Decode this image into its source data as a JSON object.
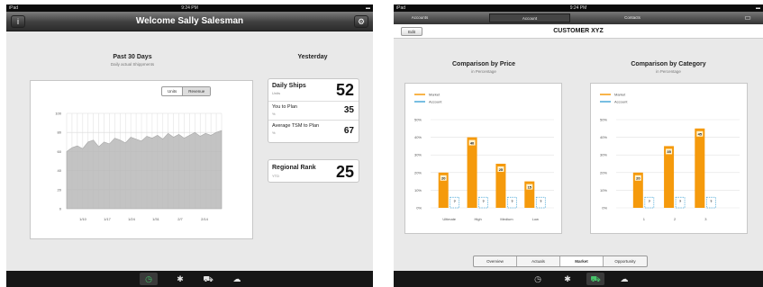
{
  "left": {
    "status": {
      "carrier": "iPad",
      "time": "9:24 PM",
      "battery": "▬"
    },
    "nav": {
      "title": "Welcome Sally Salesman",
      "info_icon": "i",
      "settings_icon": "⚙"
    },
    "chart_section": {
      "title": "Past 30 Days",
      "subtitle": "Daily actual Shippments",
      "seg_units": "Units",
      "seg_revenue": "Revenue"
    },
    "chart_data": {
      "type": "area",
      "title": "Past 30 Days",
      "subtitle": "Daily actual Shippments",
      "x_ticks": [
        "1/10",
        "1/17",
        "1/24",
        "1/31",
        "2/7",
        "2/14"
      ],
      "y_ticks": [
        "0",
        "20",
        "40",
        "60",
        "80",
        "100"
      ],
      "ylim": [
        0,
        100
      ],
      "grid": true,
      "values": [
        60,
        64,
        66,
        63,
        70,
        72,
        65,
        70,
        68,
        74,
        72,
        69,
        75,
        73,
        71,
        76,
        74,
        77,
        73,
        79,
        75,
        78,
        74,
        77,
        80,
        76,
        79,
        77,
        80,
        82
      ]
    },
    "yesterday": {
      "title": "Yesterday",
      "daily_ships_label": "Daily Ships",
      "daily_ships_unit": "Units",
      "daily_ships_value": "52",
      "plan_label": "You to Plan",
      "plan_unit": "%",
      "plan_value": "35",
      "tsm_label": "Average TSM to Plan",
      "tsm_unit": "%",
      "tsm_value": "67",
      "rank_label": "Regional Rank",
      "rank_unit": "YTD",
      "rank_value": "25"
    },
    "tabbar": {
      "tab1_icon": "◷",
      "tab2_icon": "✱",
      "tab3_icon": "⛟",
      "tab4_icon": "☁"
    }
  },
  "right": {
    "status": {
      "carrier": "iPad",
      "time": "9:24 PM",
      "battery": "▬"
    },
    "tabs": {
      "accounts": "Accounts",
      "account": "Account",
      "contacts": "Contacts",
      "screen_icon": "▭"
    },
    "header": {
      "edit": "Edit",
      "customer": "CUSTOMER XYZ"
    },
    "price": {
      "title": "Comparison by Price",
      "subtitle": "in Percentage"
    },
    "category": {
      "title": "Comparison by Category",
      "subtitle": "in Percentage"
    },
    "legend": {
      "market": "Market",
      "account": "Account"
    },
    "colors": {
      "market": "#f59a0c",
      "account": "#4aa8d8"
    },
    "chart_data": [
      {
        "type": "bar",
        "title": "Comparison by Price",
        "subtitle": "in Percentage",
        "categories": [
          "Ultimate",
          "High",
          "Medium",
          "Low"
        ],
        "y_ticks": [
          "0%",
          "10%",
          "20%",
          "30%",
          "40%",
          "50%"
        ],
        "ylim": [
          0,
          50
        ],
        "series": [
          {
            "name": "Market",
            "values": [
              20,
              40,
              25,
              15
            ],
            "labels": [
              "20",
              "40",
              "25",
              "15"
            ]
          },
          {
            "name": "Account",
            "values": [
              6,
              6,
              6,
              6
            ],
            "labels": [
              "?",
              "?",
              "?",
              "?"
            ]
          }
        ]
      },
      {
        "type": "bar",
        "title": "Comparison by Category",
        "subtitle": "in Percentage",
        "categories": [
          "1",
          "2",
          "3"
        ],
        "y_ticks": [
          "0%",
          "10%",
          "20%",
          "30%",
          "40%",
          "50%"
        ],
        "ylim": [
          0,
          50
        ],
        "series": [
          {
            "name": "Market",
            "values": [
              20,
              35,
              45
            ],
            "labels": [
              "20",
              "35",
              "45"
            ]
          },
          {
            "name": "Account",
            "values": [
              6,
              6,
              6
            ],
            "labels": [
              "?",
              "?",
              "?"
            ]
          }
        ]
      }
    ],
    "bottom_tabs": {
      "overview": "Overview",
      "actuals": "Actuals",
      "market": "Market",
      "opportunity": "Opportunity"
    },
    "tabbar": {
      "tab1_icon": "◷",
      "tab2_icon": "✱",
      "tab3_icon": "⛟",
      "tab4_icon": "☁"
    }
  }
}
